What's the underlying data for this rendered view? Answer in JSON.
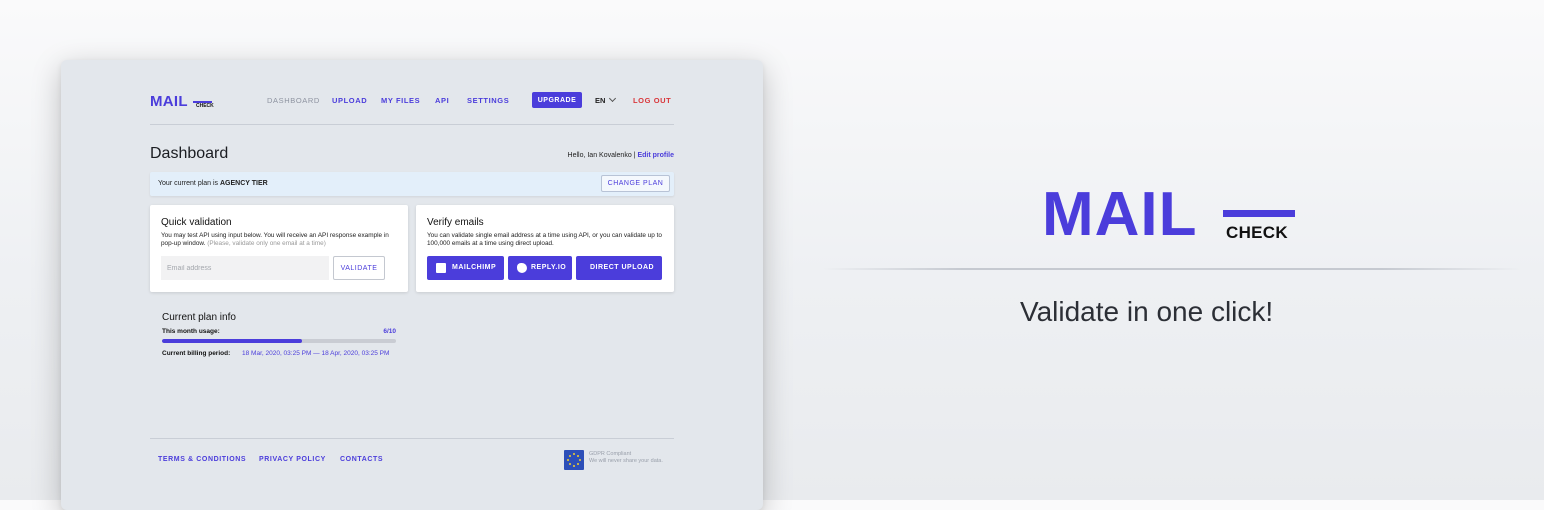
{
  "app": {
    "logo": {
      "word": "MAIL",
      "sub": "CHECK"
    },
    "nav": {
      "dashboard": "DASHBOARD",
      "upload": "UPLOAD",
      "my_files": "MY FILES",
      "api": "API",
      "settings": "SETTINGS",
      "upgrade": "UPGRADE",
      "language": "EN",
      "logout": "LOG OUT"
    },
    "page_title": "Dashboard",
    "greeting": "Hello, Ian Kovalenko | ",
    "edit_profile": "Edit profile",
    "plan_banner": {
      "prefix": "Your current plan is ",
      "plan": "AGENCY TIER",
      "button": "CHANGE PLAN"
    },
    "quick_validation": {
      "title": "Quick validation",
      "description": "You may test API using input below. You will receive an API response example in pop-up window. ",
      "note": "(Please, validate only one email at a time)",
      "placeholder": "Email address",
      "button": "VALIDATE"
    },
    "verify_emails": {
      "title": "Verify emails",
      "description": "You can validate single email address at a time using API, or you can validate up to 100,000 emails at a time using direct upload.",
      "buttons": [
        {
          "label": "MAILCHIMP",
          "icon": "mailchimp-icon"
        },
        {
          "label": "REPLY.IO",
          "icon": "replyio-icon"
        },
        {
          "label": "DIRECT UPLOAD",
          "icon": ""
        }
      ]
    },
    "plan_info": {
      "title": "Current plan info",
      "usage_label": "This month usage:",
      "usage_count": "6/10",
      "usage_fraction": 0.6,
      "billing_label": "Current billing period:",
      "billing_value": "18 Mar, 2020, 03:25 PM — 18 Apr, 2020, 03:25 PM"
    },
    "footer": {
      "terms": "TERMS & CONDITIONS",
      "privacy": "PRIVACY POLICY",
      "contacts": "CONTACTS",
      "gdpr_line1": "GDPR Compliant",
      "gdpr_line2": "We will never share your data."
    }
  },
  "brand": {
    "word": "MAIL",
    "sub": "CHECK",
    "tagline": "Validate in one click!"
  },
  "colors": {
    "accent": "#4b3ddb",
    "danger": "#d9373b",
    "banner": "#e3effa"
  }
}
